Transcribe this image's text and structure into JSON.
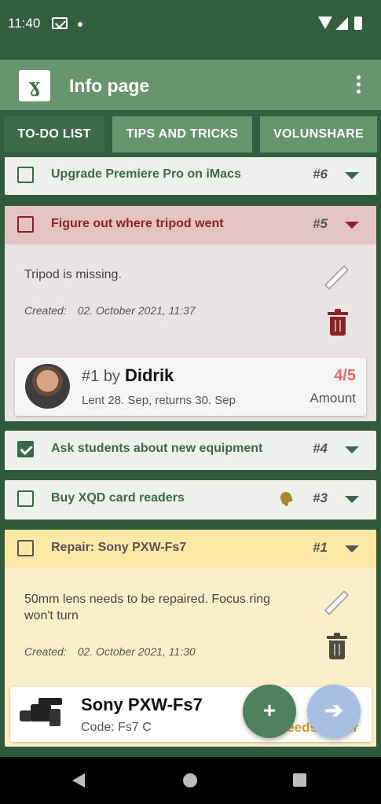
{
  "status_bar": {
    "time": "11:40"
  },
  "app_bar": {
    "title": "Info page",
    "logo_glyph": "४"
  },
  "tabs": [
    {
      "label": "TO-DO LIST",
      "active": true
    },
    {
      "label": "TIPS AND TRICKS",
      "active": false
    },
    {
      "label": "VOLUNSHARE",
      "active": false
    }
  ],
  "todos": [
    {
      "title": "Upgrade Premiere Pro on iMacs",
      "number": "#6",
      "checked": false
    },
    {
      "title": "Figure out where tripod went",
      "number": "#5",
      "checked": false,
      "expanded": true,
      "description": "Tripod is missing.",
      "created_label": "Created:",
      "created_date": "02. October 2021, 11:37",
      "loan": {
        "number": "#1",
        "by": "by",
        "name": "Didrik",
        "dates": "Lent 28. Sep, returns 30. Sep",
        "amount": "4/5",
        "amount_label": "Amount"
      }
    },
    {
      "title": "Ask students about new equipment",
      "number": "#4",
      "checked": true
    },
    {
      "title": "Buy XQD card readers",
      "number": "#3",
      "checked": false,
      "reminder": true
    },
    {
      "title": "Repair: Sony PXW-Fs7",
      "number": "#1",
      "checked": false,
      "expanded": true,
      "description": "50mm lens needs to be repaired. Focus ring won't turn",
      "created_label": "Created:",
      "created_date": "02. October 2021, 11:30",
      "equipment": {
        "name": "Sony PXW-Fs7",
        "code": "Code: Fs7 C",
        "status": "Needs repair"
      }
    }
  ],
  "fab": {
    "add": "+",
    "next": "➔"
  },
  "colors": {
    "primary": "#3a6b48",
    "app_bar": "#66956e",
    "alert_red": "#8a2323",
    "repair_yellow": "#fde7a5",
    "amount_red": "#e46a6a",
    "status_orange": "#d99b1c"
  }
}
